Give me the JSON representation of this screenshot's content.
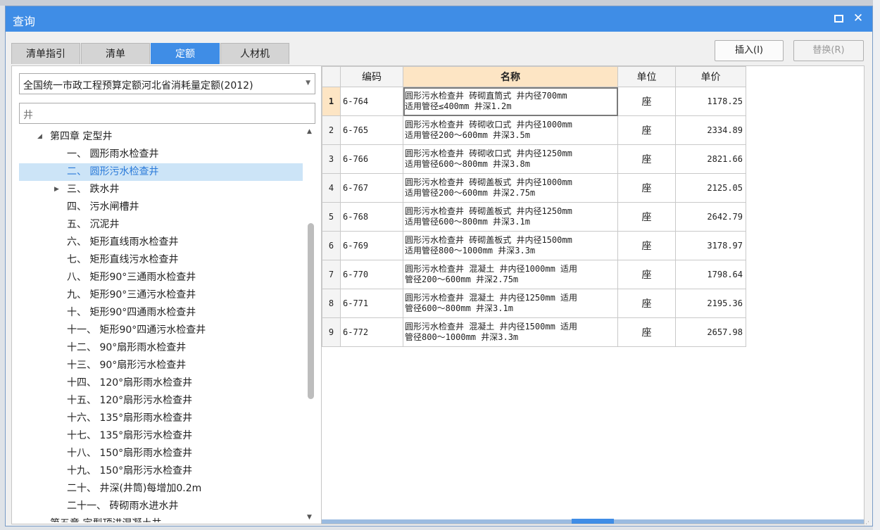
{
  "dialog": {
    "title": "查询"
  },
  "tabs": [
    {
      "label": "清单指引",
      "active": false
    },
    {
      "label": "清单",
      "active": false
    },
    {
      "label": "定额",
      "active": true
    },
    {
      "label": "人材机",
      "active": false
    }
  ],
  "buttons": {
    "insert": "插入(I)",
    "replace": "替换(R)"
  },
  "left": {
    "library": "全国统一市政工程预算定额河北省消耗量定额(2012)",
    "search_value": "井",
    "tree": [
      {
        "label": "第四章 定型井",
        "twisty": "expanded",
        "level": 0,
        "selected": false
      },
      {
        "label": "一、 圆形雨水检查井",
        "twisty": "",
        "level": 1,
        "selected": false
      },
      {
        "label": "二、 圆形污水检查井",
        "twisty": "",
        "level": 1,
        "selected": true
      },
      {
        "label": "三、 跌水井",
        "twisty": "collapsed",
        "level": 1,
        "selected": false
      },
      {
        "label": "四、 污水闸槽井",
        "twisty": "",
        "level": 1,
        "selected": false
      },
      {
        "label": "五、 沉泥井",
        "twisty": "",
        "level": 1,
        "selected": false
      },
      {
        "label": "六、 矩形直线雨水检查井",
        "twisty": "",
        "level": 1,
        "selected": false
      },
      {
        "label": "七、 矩形直线污水检查井",
        "twisty": "",
        "level": 1,
        "selected": false
      },
      {
        "label": "八、 矩形90°三通雨水检查井",
        "twisty": "",
        "level": 1,
        "selected": false
      },
      {
        "label": "九、 矩形90°三通污水检查井",
        "twisty": "",
        "level": 1,
        "selected": false
      },
      {
        "label": "十、 矩形90°四通雨水检查井",
        "twisty": "",
        "level": 1,
        "selected": false
      },
      {
        "label": "十一、 矩形90°四通污水检查井",
        "twisty": "",
        "level": 1,
        "selected": false
      },
      {
        "label": "十二、 90°扇形雨水检查井",
        "twisty": "",
        "level": 1,
        "selected": false
      },
      {
        "label": "十三、 90°扇形污水检查井",
        "twisty": "",
        "level": 1,
        "selected": false
      },
      {
        "label": "十四、 120°扇形雨水检查井",
        "twisty": "",
        "level": 1,
        "selected": false
      },
      {
        "label": "十五、 120°扇形污水检查井",
        "twisty": "",
        "level": 1,
        "selected": false
      },
      {
        "label": "十六、 135°扇形雨水检查井",
        "twisty": "",
        "level": 1,
        "selected": false
      },
      {
        "label": "十七、 135°扇形污水检查井",
        "twisty": "",
        "level": 1,
        "selected": false
      },
      {
        "label": "十八、 150°扇形雨水检查井",
        "twisty": "",
        "level": 1,
        "selected": false
      },
      {
        "label": "十九、 150°扇形污水检查井",
        "twisty": "",
        "level": 1,
        "selected": false
      },
      {
        "label": "二十、 井深(井筒)每增加0.2m",
        "twisty": "",
        "level": 1,
        "selected": false
      },
      {
        "label": "二十一、 砖砌雨水进水井",
        "twisty": "",
        "level": 1,
        "selected": false
      },
      {
        "label": "第五章 定型顶进混凝土井",
        "twisty": "",
        "level": 0,
        "selected": false
      }
    ]
  },
  "grid": {
    "headers": {
      "code": "编码",
      "name": "名称",
      "unit": "单位",
      "price": "单价"
    },
    "rows": [
      {
        "idx": "1",
        "code": "6-764",
        "name1": "圆形污水检查井 砖砌直筒式 井内径700mm",
        "name2": "适用管径≤400mm 井深1.2m",
        "unit": "座",
        "price": "1178.25",
        "current": true
      },
      {
        "idx": "2",
        "code": "6-765",
        "name1": "圆形污水检查井 砖砌收口式 井内径1000mm",
        "name2": "适用管径200～600mm 井深3.5m",
        "unit": "座",
        "price": "2334.89",
        "current": false
      },
      {
        "idx": "3",
        "code": "6-766",
        "name1": "圆形污水检查井 砖砌收口式 井内径1250mm",
        "name2": "适用管径600～800mm 井深3.8m",
        "unit": "座",
        "price": "2821.66",
        "current": false
      },
      {
        "idx": "4",
        "code": "6-767",
        "name1": "圆形污水检查井 砖砌盖板式 井内径1000mm",
        "name2": "适用管径200～600mm 井深2.75m",
        "unit": "座",
        "price": "2125.05",
        "current": false
      },
      {
        "idx": "5",
        "code": "6-768",
        "name1": "圆形污水检查井 砖砌盖板式 井内径1250mm",
        "name2": "适用管径600～800mm 井深3.1m",
        "unit": "座",
        "price": "2642.79",
        "current": false
      },
      {
        "idx": "6",
        "code": "6-769",
        "name1": "圆形污水检查井 砖砌盖板式 井内径1500mm",
        "name2": "适用管径800～1000mm 井深3.3m",
        "unit": "座",
        "price": "3178.97",
        "current": false
      },
      {
        "idx": "7",
        "code": "6-770",
        "name1": "圆形污水检查井 混凝土 井内径1000mm 适用",
        "name2": "管径200～600mm 井深2.75m",
        "unit": "座",
        "price": "1798.64",
        "current": false
      },
      {
        "idx": "8",
        "code": "6-771",
        "name1": "圆形污水检查井 混凝土 井内径1250mm 适用",
        "name2": "管径600～800mm 井深3.1m",
        "unit": "座",
        "price": "2195.36",
        "current": false
      },
      {
        "idx": "9",
        "code": "6-772",
        "name1": "圆形污水检查井 混凝土 井内径1500mm 适用",
        "name2": "管径800～1000mm 井深3.3m",
        "unit": "座",
        "price": "2657.98",
        "current": false
      }
    ]
  },
  "icons": {
    "maximize": "maximize-icon",
    "close": "close-icon",
    "dropdown": "chevron-down-icon",
    "expanded": "triangle-down-icon",
    "collapsed": "triangle-right-icon"
  },
  "colors": {
    "accent": "#3f8de6",
    "selected_row": "#cce4f7",
    "header_highlight": "#fde5c4"
  }
}
